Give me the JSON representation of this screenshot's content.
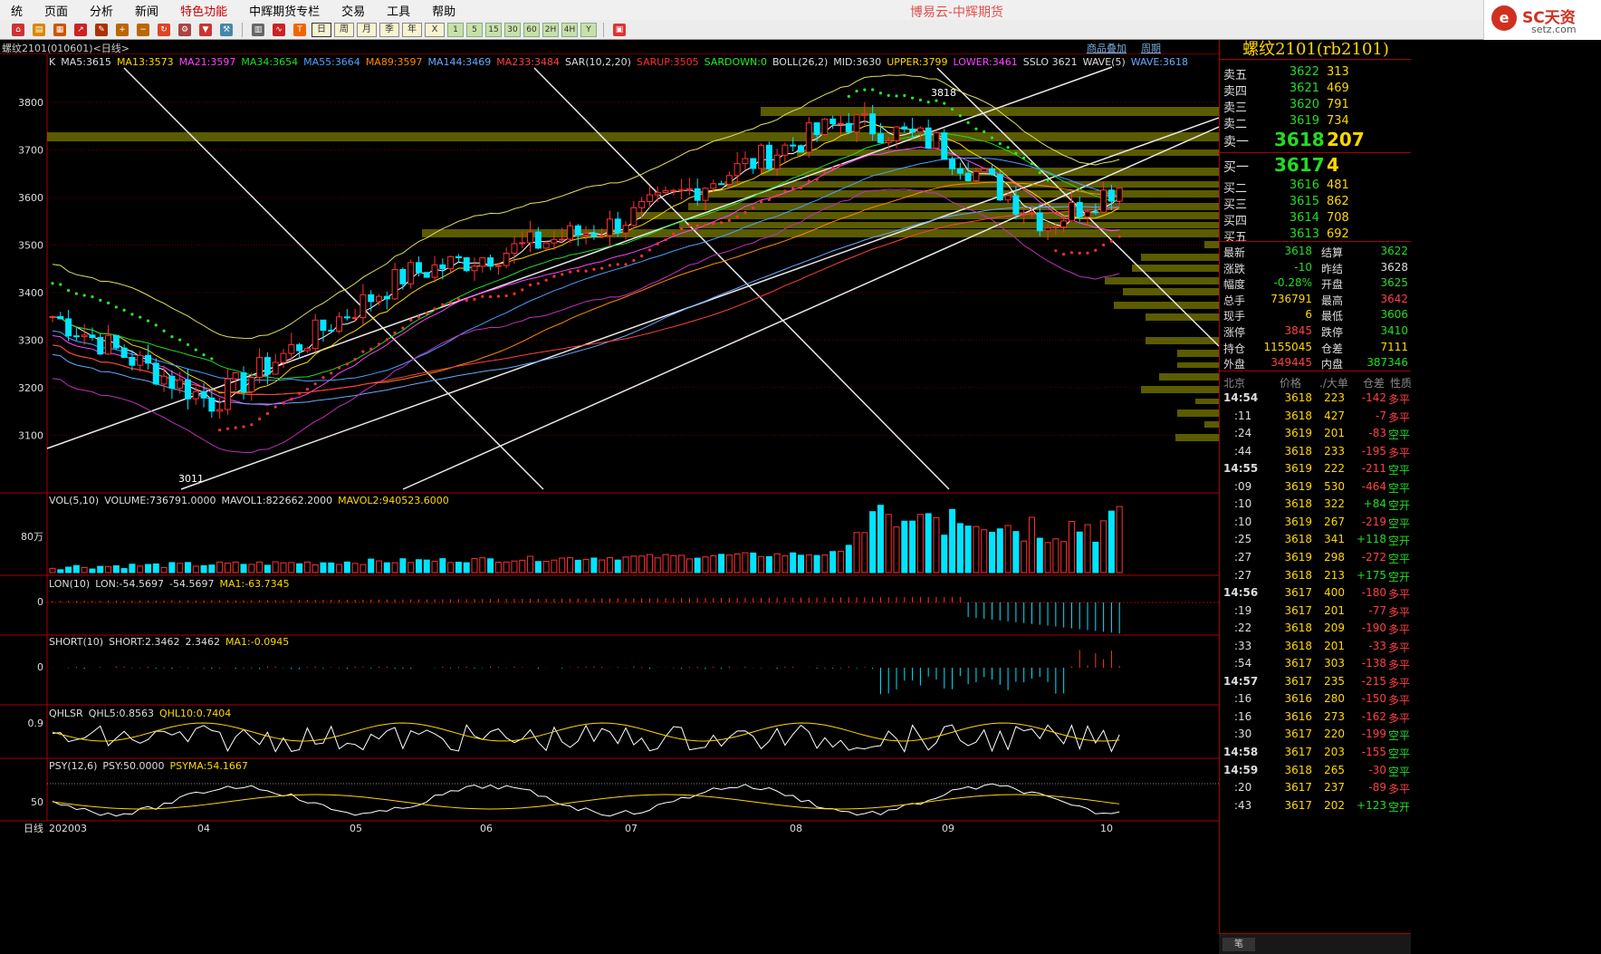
{
  "menu": {
    "items": [
      "统",
      "页面",
      "分析",
      "新闻",
      "特色功能",
      "中辉期货专栏",
      "交易",
      "工具",
      "帮助"
    ],
    "highlight_index": 4,
    "app_title": "博易云-中辉期货"
  },
  "logo": {
    "mark": "e",
    "brand": "SC天资",
    "site": "setz.com"
  },
  "toolbar": {
    "periods": [
      "日",
      "周",
      "月",
      "季",
      "年"
    ],
    "minutes": [
      "1",
      "5",
      "15",
      "30",
      "60",
      "2H",
      "4H",
      "Y"
    ],
    "x_label": "X"
  },
  "section": {
    "title": "螺纹2101(010601)<日线>",
    "overlay_link": "商品叠加",
    "cycle_link": "周期"
  },
  "main_chart": {
    "legend": [
      {
        "text": "K",
        "color": "#dddddd"
      },
      {
        "text": "MA5:3615",
        "color": "#dddddd"
      },
      {
        "text": "MA13:3573",
        "color": "#ffd700"
      },
      {
        "text": "MA21:3597",
        "color": "#ff44ff"
      },
      {
        "text": "MA34:3654",
        "color": "#22dd22"
      },
      {
        "text": "MA55:3664",
        "color": "#4aa0ff"
      },
      {
        "text": "MA89:3597",
        "color": "#ff8800"
      },
      {
        "text": "MA144:3469",
        "color": "#6aa8ff"
      },
      {
        "text": "MA233:3484",
        "color": "#ff4040"
      },
      {
        "text": "SAR(10,2,20)",
        "color": "#dddddd"
      },
      {
        "text": "SARUP:3505",
        "color": "#ff3030"
      },
      {
        "text": "SARDOWN:0",
        "color": "#22ee22"
      },
      {
        "text": "BOLL(26,2)",
        "color": "#dddddd"
      },
      {
        "text": "MID:3630",
        "color": "#dddddd"
      },
      {
        "text": "UPPER:3799",
        "color": "#ffd700"
      },
      {
        "text": "LOWER:3461",
        "color": "#ff44ff"
      },
      {
        "text": "SSLO 3621",
        "color": "#dddddd"
      },
      {
        "text": "WAVE(5)",
        "color": "#dddddd"
      },
      {
        "text": "WAVE:3618",
        "color": "#6aa8ff"
      }
    ],
    "y_ticks": [
      "3800",
      "3700",
      "3600",
      "3500",
      "3400",
      "3300",
      "3200",
      "3100"
    ],
    "high_label": "3818",
    "low_label": "3011"
  },
  "indicators": {
    "vol": {
      "parts": [
        {
          "text": "VOL(5,10)",
          "color": "#dddddd"
        },
        {
          "text": "VOLUME:736791.0000",
          "color": "#dddddd"
        },
        {
          "text": "MAVOL1:822662.2000",
          "color": "#dddddd"
        },
        {
          "text": "MAVOL2:940523.6000",
          "color": "#ffd700"
        }
      ],
      "y_tick": "80万"
    },
    "lon": {
      "parts": [
        {
          "text": "LON(10)",
          "color": "#dddddd"
        },
        {
          "text": "LON:-54.5697",
          "color": "#dddddd"
        },
        {
          "text": "-54.5697",
          "color": "#dddddd"
        },
        {
          "text": "MA1:-63.7345",
          "color": "#ffd700"
        }
      ],
      "y_tick": "0"
    },
    "short": {
      "parts": [
        {
          "text": "SHORT(10)",
          "color": "#dddddd"
        },
        {
          "text": "SHORT:2.3462",
          "color": "#dddddd"
        },
        {
          "text": "2.3462",
          "color": "#dddddd"
        },
        {
          "text": "MA1:-0.0945",
          "color": "#ffd700"
        }
      ],
      "y_tick": "0"
    },
    "qhlsr": {
      "parts": [
        {
          "text": "QHLSR",
          "color": "#dddddd"
        },
        {
          "text": "QHL5:0.8563",
          "color": "#dddddd"
        },
        {
          "text": "QHL10:0.7404",
          "color": "#ffd700"
        }
      ],
      "y_tick": "0.9"
    },
    "psy": {
      "parts": [
        {
          "text": "PSY(12,6)",
          "color": "#dddddd"
        },
        {
          "text": "PSY:50.0000",
          "color": "#dddddd"
        },
        {
          "text": "PSYMA:54.1667",
          "color": "#ffd700"
        }
      ],
      "y_tick": "50"
    }
  },
  "x_axis": {
    "left_label": "日线",
    "labels": [
      "202003",
      "04",
      "05",
      "06",
      "07",
      "08",
      "09",
      "10"
    ]
  },
  "quote": {
    "title": "螺纹2101(rb2101)",
    "asks": [
      {
        "label": "卖五",
        "price": "3622",
        "vol": "313"
      },
      {
        "label": "卖四",
        "price": "3621",
        "vol": "469"
      },
      {
        "label": "卖三",
        "price": "3620",
        "vol": "791"
      },
      {
        "label": "卖二",
        "price": "3619",
        "vol": "734"
      },
      {
        "label": "卖一",
        "price": "3618",
        "vol": "207"
      }
    ],
    "bids": [
      {
        "label": "买一",
        "price": "3617",
        "vol": "4"
      },
      {
        "label": "买二",
        "price": "3616",
        "vol": "481"
      },
      {
        "label": "买三",
        "price": "3615",
        "vol": "862"
      },
      {
        "label": "买四",
        "price": "3614",
        "vol": "708"
      },
      {
        "label": "买五",
        "price": "3613",
        "vol": "692"
      }
    ],
    "stats": [
      {
        "k1": "最新",
        "v1": "3618",
        "c1": "#22dd22",
        "k2": "结算",
        "v2": "3622",
        "c2": "#22dd22"
      },
      {
        "k1": "涨跌",
        "v1": "-10",
        "c1": "#22dd22",
        "k2": "昨结",
        "v2": "3628",
        "c2": "#dddddd"
      },
      {
        "k1": "幅度",
        "v1": "-0.28%",
        "c1": "#22dd22",
        "k2": "开盘",
        "v2": "3625",
        "c2": "#22dd22"
      },
      {
        "k1": "总手",
        "v1": "736791",
        "c1": "#ffd700",
        "k2": "最高",
        "v2": "3642",
        "c2": "#ff4040"
      },
      {
        "k1": "现手",
        "v1": "6",
        "c1": "#ffd700",
        "k2": "最低",
        "v2": "3606",
        "c2": "#22dd22"
      },
      {
        "k1": "涨停",
        "v1": "3845",
        "c1": "#ff4040",
        "k2": "跌停",
        "v2": "3410",
        "c2": "#22dd22"
      },
      {
        "k1": "持仓",
        "v1": "1155045",
        "c1": "#ffd700",
        "k2": "仓差",
        "v2": "7111",
        "c2": "#ffd700"
      },
      {
        "k1": "外盘",
        "v1": "349445",
        "c1": "#ff4040",
        "k2": "内盘",
        "v2": "387346",
        "c2": "#22dd22"
      }
    ],
    "tick_header": [
      "北京",
      "价格",
      "./大单",
      "仓差",
      "性质"
    ],
    "ticks": [
      {
        "t": "14:54",
        "p": "3618",
        "v": "223",
        "d": "-142",
        "n": "多平",
        "nc": "#ff4040"
      },
      {
        "t": ":11",
        "p": "3618",
        "v": "427",
        "d": "-7",
        "n": "多平",
        "nc": "#ff4040"
      },
      {
        "t": ":24",
        "p": "3619",
        "v": "201",
        "d": "-83",
        "n": "空平",
        "nc": "#22dd22"
      },
      {
        "t": ":44",
        "p": "3618",
        "v": "233",
        "d": "-195",
        "n": "多平",
        "nc": "#ff4040"
      },
      {
        "t": "14:55",
        "p": "3619",
        "v": "222",
        "d": "-211",
        "n": "空平",
        "nc": "#22dd22"
      },
      {
        "t": ":09",
        "p": "3619",
        "v": "530",
        "d": "-464",
        "n": "空平",
        "nc": "#22dd22"
      },
      {
        "t": ":10",
        "p": "3618",
        "v": "322",
        "d": "+84",
        "n": "空开",
        "nc": "#22dd22"
      },
      {
        "t": ":10",
        "p": "3619",
        "v": "267",
        "d": "-219",
        "n": "空平",
        "nc": "#22dd22"
      },
      {
        "t": ":25",
        "p": "3618",
        "v": "341",
        "d": "+118",
        "n": "空开",
        "nc": "#22dd22"
      },
      {
        "t": ":27",
        "p": "3619",
        "v": "298",
        "d": "-272",
        "n": "空平",
        "nc": "#22dd22"
      },
      {
        "t": ":27",
        "p": "3618",
        "v": "213",
        "d": "+175",
        "n": "空开",
        "nc": "#22dd22"
      },
      {
        "t": "14:56",
        "p": "3617",
        "v": "400",
        "d": "-180",
        "n": "多平",
        "nc": "#ff4040"
      },
      {
        "t": ":19",
        "p": "3617",
        "v": "201",
        "d": "-77",
        "n": "多平",
        "nc": "#ff4040"
      },
      {
        "t": ":22",
        "p": "3618",
        "v": "209",
        "d": "-190",
        "n": "多平",
        "nc": "#ff4040"
      },
      {
        "t": ":33",
        "p": "3618",
        "v": "201",
        "d": "-33",
        "n": "多平",
        "nc": "#ff4040"
      },
      {
        "t": ":54",
        "p": "3617",
        "v": "303",
        "d": "-138",
        "n": "多平",
        "nc": "#ff4040"
      },
      {
        "t": "14:57",
        "p": "3617",
        "v": "235",
        "d": "-215",
        "n": "多平",
        "nc": "#ff4040"
      },
      {
        "t": ":16",
        "p": "3616",
        "v": "280",
        "d": "-150",
        "n": "多平",
        "nc": "#ff4040"
      },
      {
        "t": ":16",
        "p": "3616",
        "v": "273",
        "d": "-162",
        "n": "多平",
        "nc": "#ff4040"
      },
      {
        "t": ":30",
        "p": "3617",
        "v": "220",
        "d": "-199",
        "n": "空平",
        "nc": "#22dd22"
      },
      {
        "t": "14:58",
        "p": "3617",
        "v": "203",
        "d": "-155",
        "n": "空平",
        "nc": "#22dd22"
      },
      {
        "t": "14:59",
        "p": "3618",
        "v": "265",
        "d": "-30",
        "n": "空平",
        "nc": "#22dd22"
      },
      {
        "t": ":20",
        "p": "3617",
        "v": "237",
        "d": "-89",
        "n": "多平",
        "nc": "#ff4040"
      },
      {
        "t": ":43",
        "p": "3617",
        "v": "202",
        "d": "+123",
        "n": "空开",
        "nc": "#22dd22"
      }
    ],
    "bottom_tab": "笔"
  },
  "colors": {
    "up": "#ff3030",
    "down": "#00e5ff",
    "band": "#6b6b00",
    "grid": "#600000"
  }
}
